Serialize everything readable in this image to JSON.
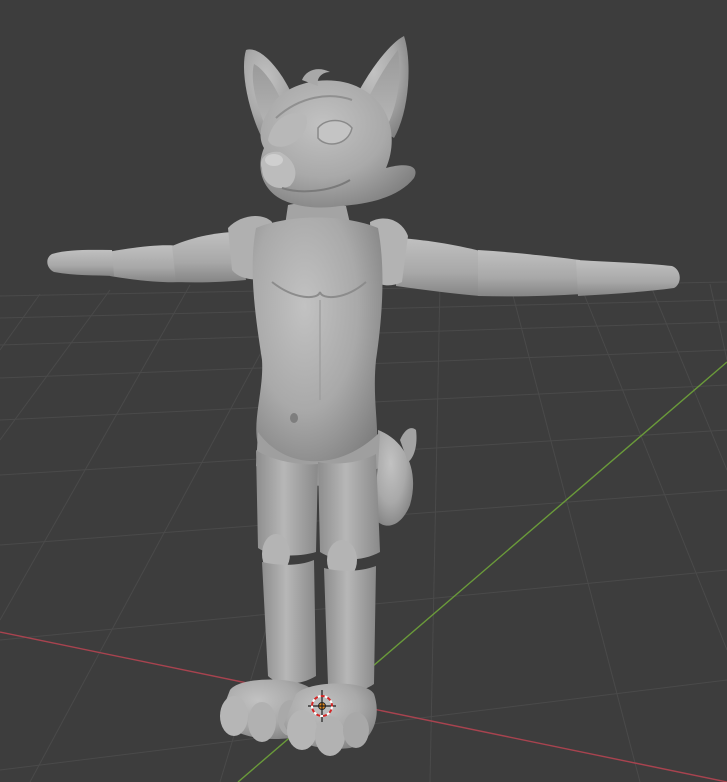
{
  "viewport": {
    "mode": "solid-shading",
    "background_color": "#3d3d3d",
    "grid_color": "#4a4a4a",
    "x_axis_color": "#a8434f",
    "y_axis_color": "#6a9a3a",
    "model_color": "#a6a6a6",
    "cursor_icon": "3d-cursor-icon",
    "origin_icon": "object-origin-icon"
  }
}
